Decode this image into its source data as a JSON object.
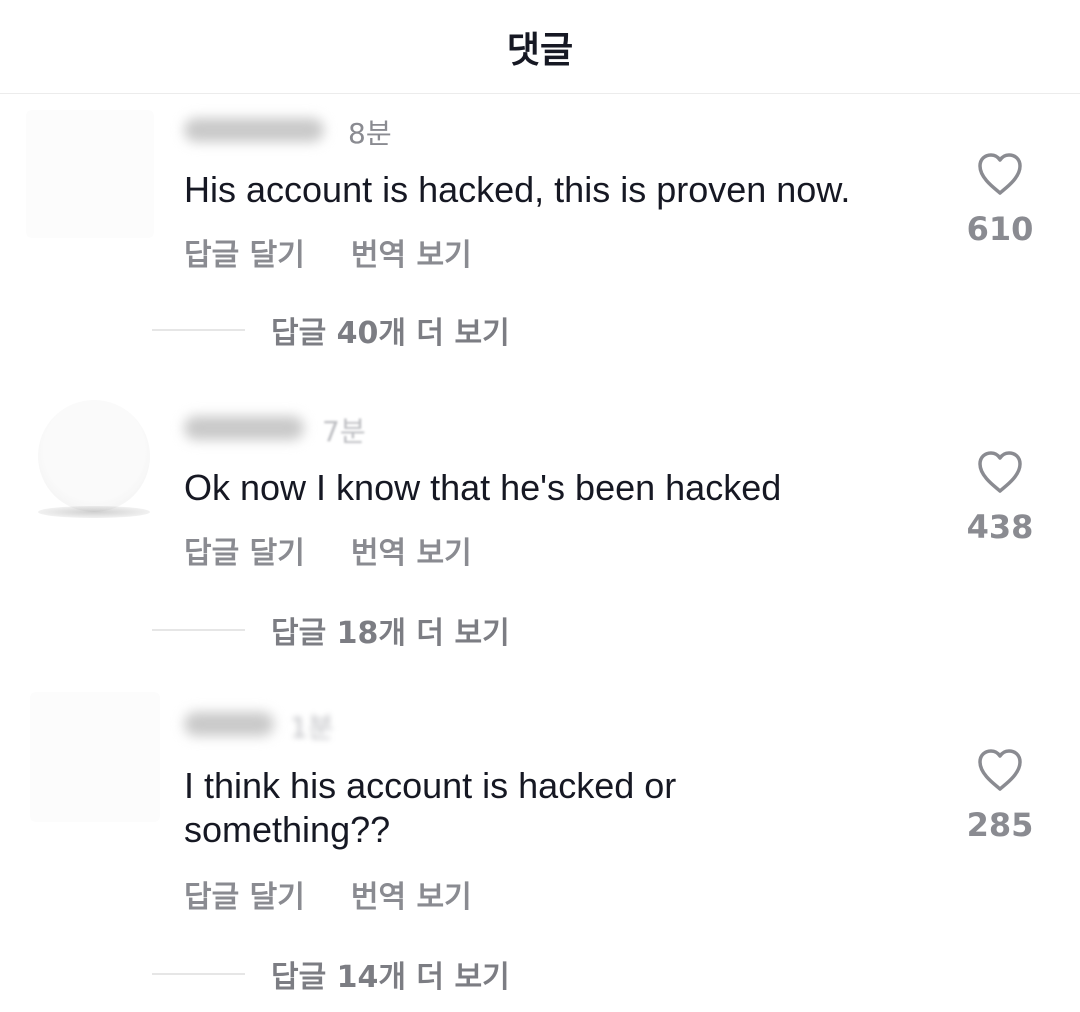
{
  "header": {
    "title": "댓글"
  },
  "comments": [
    {
      "timestamp": "8분",
      "text": "His account is hacked, this is proven now.",
      "actions": {
        "reply": "답글 달기",
        "translate": "번역 보기"
      },
      "likes": "610",
      "more_replies": "답글 40개 더 보기"
    },
    {
      "timestamp": "7분",
      "text": "Ok now I know that he's been hacked",
      "actions": {
        "reply": "답글 달기",
        "translate": "번역 보기"
      },
      "likes": "438",
      "more_replies": "답글 18개 더 보기"
    },
    {
      "timestamp": "1분",
      "text": "I think his account is hacked or something??",
      "actions": {
        "reply": "답글 달기",
        "translate": "번역 보기"
      },
      "likes": "285",
      "more_replies": "답글 14개 더 보기"
    }
  ],
  "icons": {
    "like": "heart-outline-icon"
  },
  "colors": {
    "secondary_text": "#8a8b91",
    "primary_text": "#161823",
    "divider": "#e6e6e6"
  }
}
